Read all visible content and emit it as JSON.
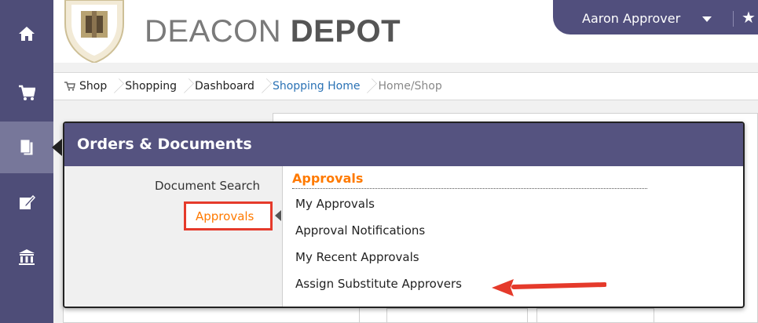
{
  "brand": {
    "light": "DEACON",
    "bold": "DEPOT"
  },
  "user": {
    "name": "Aaron Approver"
  },
  "nav": {
    "icons": [
      "home-icon",
      "cart-icon",
      "documents-icon",
      "edit-icon",
      "bank-icon"
    ]
  },
  "breadcrumb": {
    "items": [
      {
        "label": "Shop"
      },
      {
        "label": "Shopping"
      },
      {
        "label": "Dashboard"
      },
      {
        "label": "Shopping Home"
      },
      {
        "label": "Home/Shop"
      }
    ]
  },
  "flyout": {
    "title": "Orders & Documents",
    "left_items": [
      "Document Search",
      "Approvals"
    ],
    "section_title": "Approvals",
    "menu": [
      "My Approvals",
      "Approval Notifications",
      "My Recent Approvals",
      "Assign Substitute Approvers"
    ]
  },
  "colors": {
    "nav_bg": "#4e4d78",
    "accent_orange": "#ff7a00",
    "highlight_red": "#e53a2b",
    "link_blue": "#2a72b5"
  }
}
